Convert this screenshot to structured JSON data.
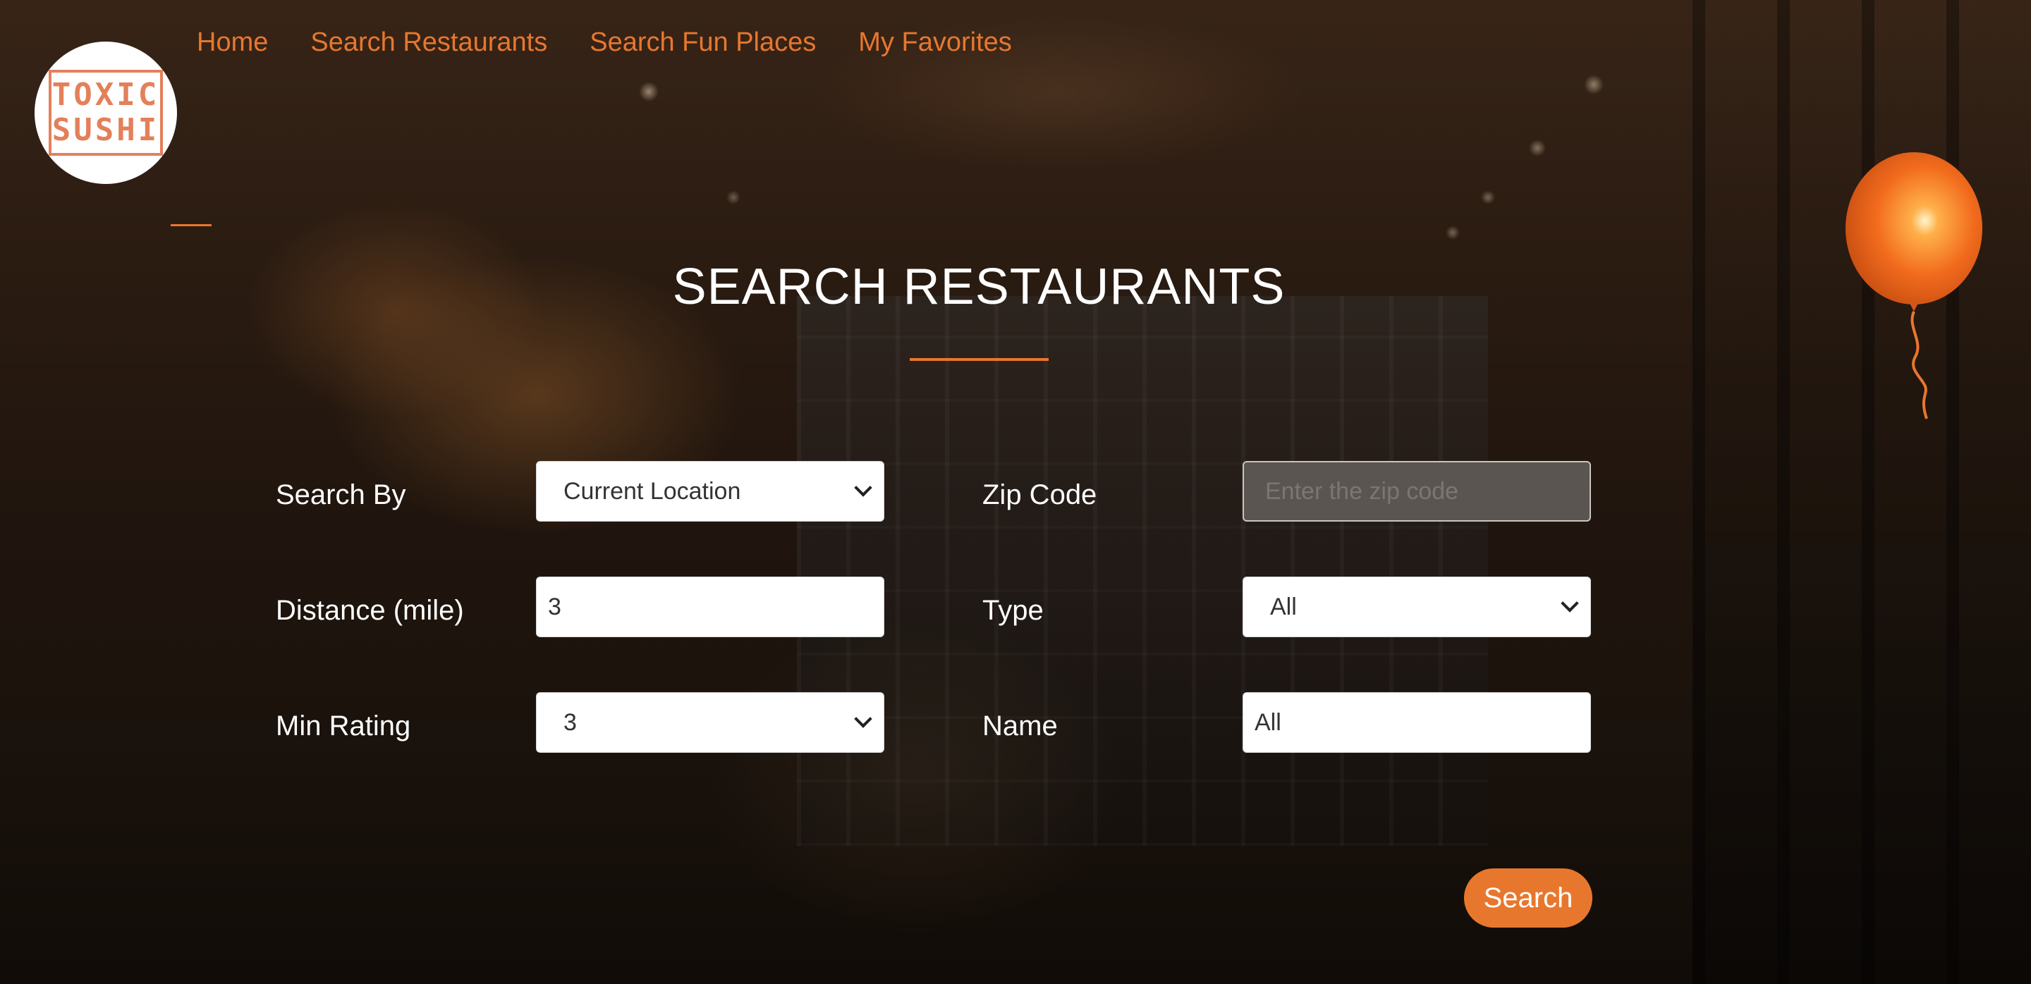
{
  "nav": {
    "items": [
      {
        "label": "Home"
      },
      {
        "label": "Search Restaurants"
      },
      {
        "label": "Search Fun Places"
      },
      {
        "label": "My Favorites"
      }
    ]
  },
  "logo": {
    "line1": "TOXIC",
    "line2": "SUSHI"
  },
  "page": {
    "title": "SEARCH RESTAURANTS"
  },
  "form": {
    "search_by": {
      "label": "Search By",
      "value": "Current Location"
    },
    "zip_code": {
      "label": "Zip Code",
      "value": "",
      "placeholder": "Enter the zip code"
    },
    "distance": {
      "label": "Distance (mile)",
      "value": "3"
    },
    "type": {
      "label": "Type",
      "value": "All"
    },
    "min_rating": {
      "label": "Min Rating",
      "value": "3"
    },
    "name": {
      "label": "Name",
      "value": "All"
    },
    "search_label": "Search"
  },
  "colors": {
    "accent": "#e8772e",
    "text": "#ffffff"
  },
  "icons": {
    "balloon": "balloon-icon",
    "dropdown": "chevron-down-icon"
  }
}
